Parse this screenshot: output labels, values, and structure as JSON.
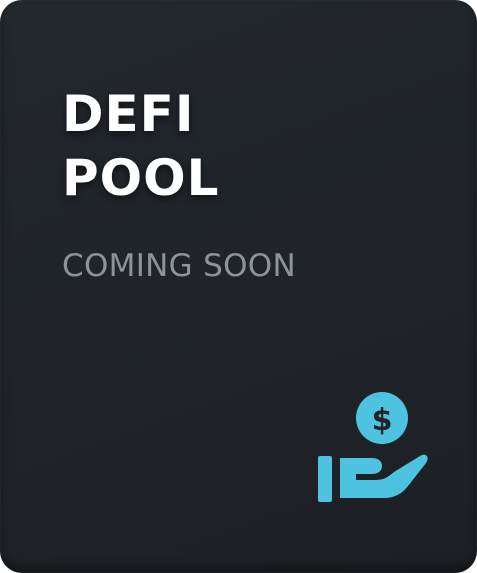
{
  "card": {
    "title_line1": "DEFI",
    "title_line2": "POOL",
    "status": "COMING SOON",
    "icon": "hand-holding-dollar-icon",
    "icon_symbol": "$"
  },
  "colors": {
    "card_background": "#202428",
    "title": "#ffffff",
    "status": "#8e9399",
    "icon_accent": "#4ec3df",
    "icon_dark": "#202428"
  }
}
